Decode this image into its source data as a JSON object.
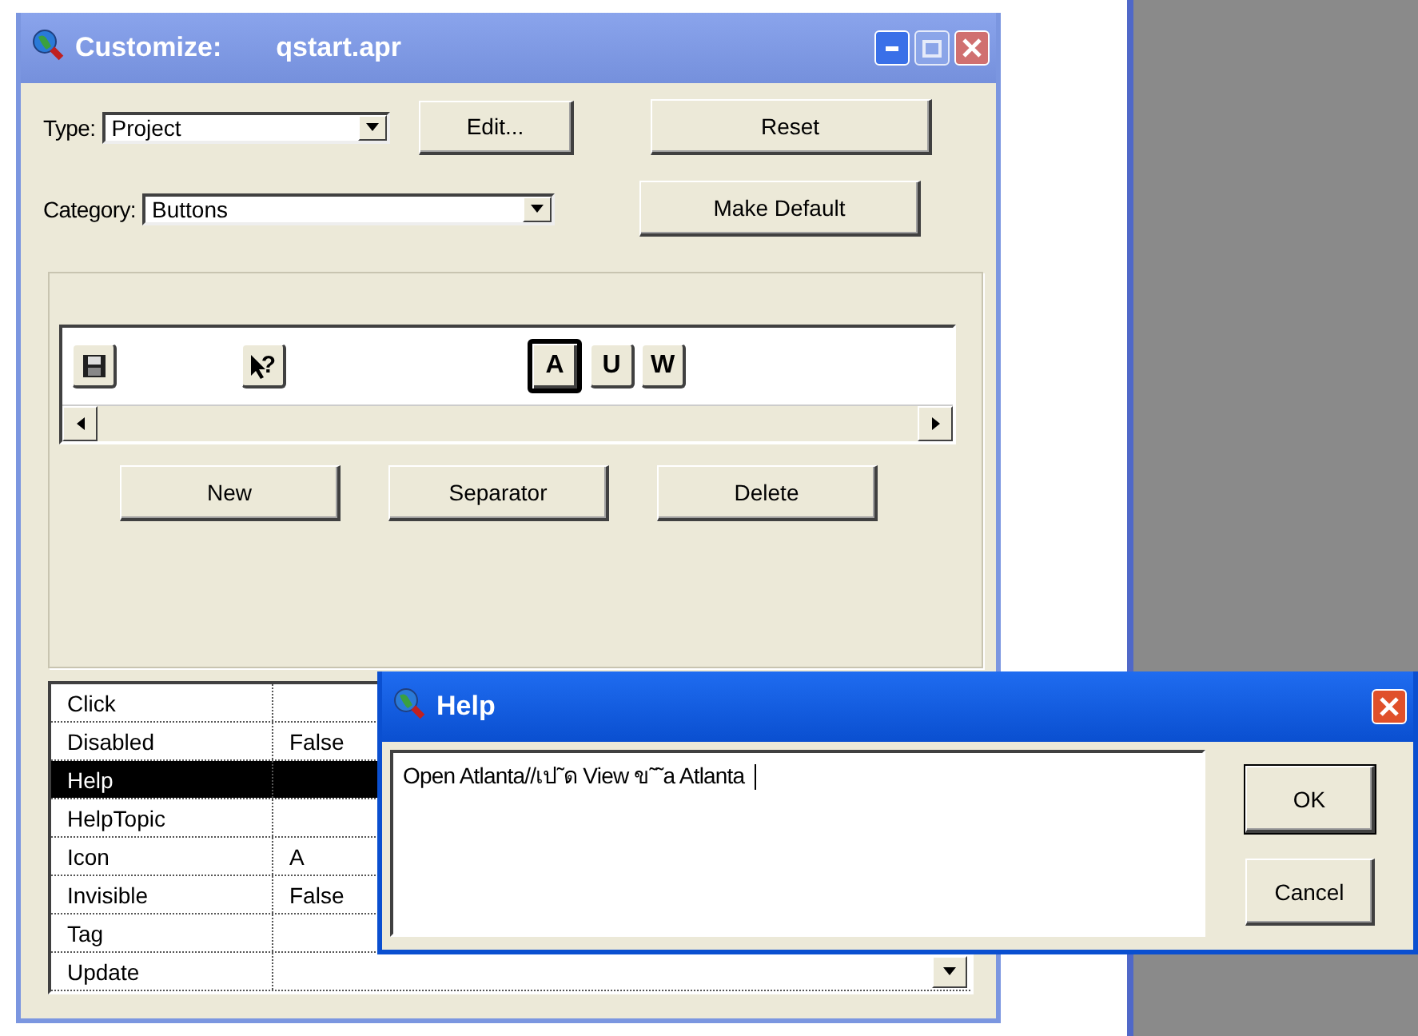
{
  "customize_window": {
    "title": "Customize:",
    "document": "qstart.apr",
    "active": false,
    "type_field": {
      "label": "Type:",
      "value": "Project"
    },
    "edit_button": "Edit...",
    "reset_button": "Reset",
    "category_field": {
      "label": "Category:",
      "value": "Buttons"
    },
    "make_default_button": "Make Default",
    "toolbar_items": [
      {
        "kind": "floppy",
        "selected": false
      },
      {
        "kind": "separator"
      },
      {
        "kind": "help-cursor",
        "label": "?",
        "selected": false
      },
      {
        "kind": "separator"
      },
      {
        "kind": "separator"
      },
      {
        "kind": "letter",
        "label": "A",
        "selected": true
      },
      {
        "kind": "letter",
        "label": "U",
        "selected": false
      },
      {
        "kind": "letter",
        "label": "W",
        "selected": false
      }
    ],
    "toolbar_actions": [
      "New",
      "Separator",
      "Delete"
    ],
    "properties": [
      {
        "name": "Click",
        "kind": "text",
        "selected": false
      },
      {
        "name": "Disabled",
        "kind": "text",
        "value": "False",
        "selected": false
      },
      {
        "name": "Help",
        "kind": "text",
        "selected": true
      },
      {
        "name": "HelpTopic",
        "kind": "text",
        "selected": false
      },
      {
        "name": "Icon",
        "kind": "text",
        "value": "A",
        "selected": false
      },
      {
        "name": "Invisible",
        "kind": "text",
        "value": "False",
        "selected": false
      },
      {
        "name": "Tag",
        "kind": "text",
        "selected": false
      },
      {
        "name": "Update",
        "kind": "dropdown",
        "selected": false
      }
    ]
  },
  "help_dialog": {
    "title": "Help",
    "active": true,
    "value": "Open Atlanta//เป˜ด View ข˜˜a Atlanta",
    "buttons": [
      "OK",
      "Cancel"
    ]
  }
}
